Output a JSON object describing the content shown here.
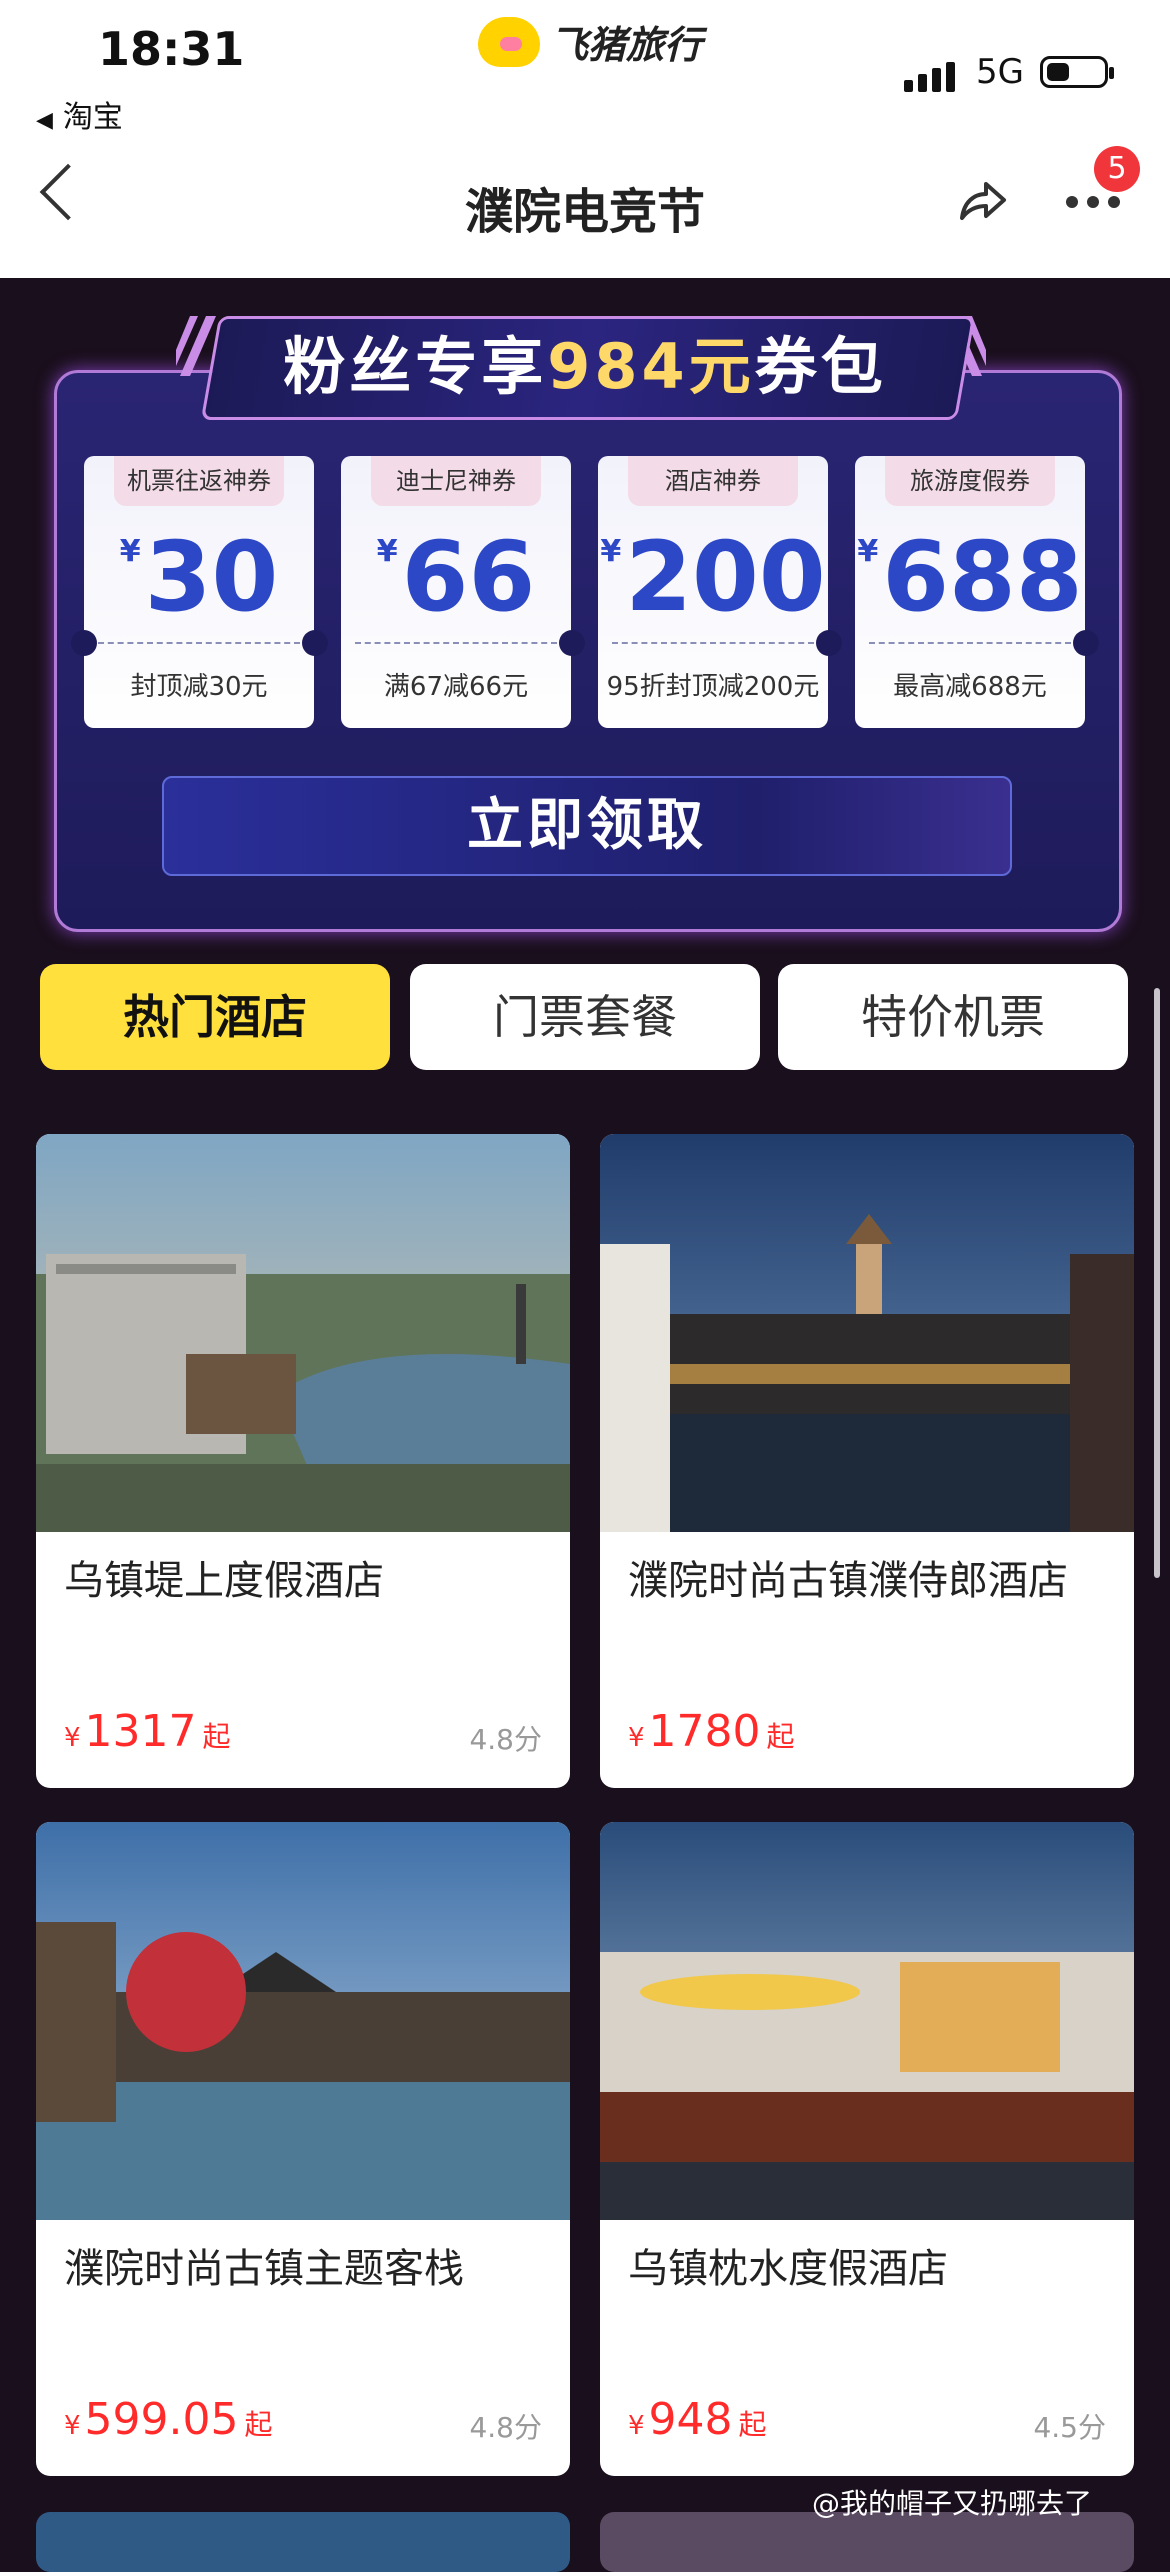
{
  "status": {
    "time": "18:31",
    "back_app": "淘宝",
    "network": "5G"
  },
  "brand": {
    "name": "飞猪旅行"
  },
  "nav": {
    "title": "濮院电竞节",
    "more_badge": "5"
  },
  "colors": {
    "accent_yellow": "#ffe03c",
    "price_red": "#ff2a2a",
    "coupon_blue": "#2d48c6",
    "panel": "#1e1b5a"
  },
  "coupon_pack": {
    "title_a": "粉丝专享",
    "title_amount": "984元",
    "title_b": "券包",
    "currency": "¥",
    "coupons": [
      {
        "tag": "机票往返神券",
        "amount": "30",
        "desc": "封顶减30元"
      },
      {
        "tag": "迪士尼神券",
        "amount": "66",
        "desc": "满67减66元"
      },
      {
        "tag": "酒店神券",
        "amount": "200",
        "desc": "95折封顶减200元"
      },
      {
        "tag": "旅游度假券",
        "amount": "688",
        "desc": "最高减688元"
      }
    ],
    "claim_label": "立即领取"
  },
  "tabs": [
    {
      "label": "热门酒店",
      "active": true
    },
    {
      "label": "门票套餐",
      "active": false
    },
    {
      "label": "特价机票",
      "active": false
    }
  ],
  "price_suffix": "起",
  "hotels": [
    {
      "name": "乌镇堤上度假酒店",
      "currency": "¥",
      "price": "1317",
      "score": "4.8分"
    },
    {
      "name": "濮院时尚古镇濮侍郎酒店",
      "currency": "¥",
      "price": "1780",
      "score": ""
    },
    {
      "name": "濮院时尚古镇主题客栈",
      "currency": "¥",
      "price": "599.05",
      "score": "4.8分"
    },
    {
      "name": "乌镇枕水度假酒店",
      "currency": "¥",
      "price": "948",
      "score": "4.5分"
    }
  ],
  "watermark": "@我的帽子又扔哪去了"
}
